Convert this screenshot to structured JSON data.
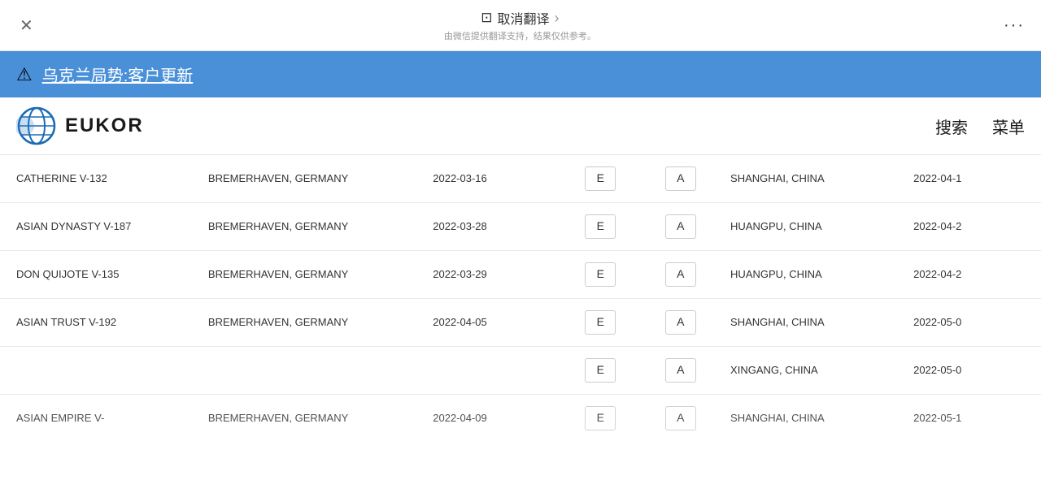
{
  "topbar": {
    "close_label": "✕",
    "translate_icon": "⊞",
    "translate_label": "取消翻译",
    "translate_chevron": "›",
    "translate_subtitle": "由微信提供翻译支持，结果仅供参考。",
    "more_label": "···"
  },
  "warning": {
    "icon": "⚠",
    "text": "乌克兰局势:客户更新"
  },
  "header": {
    "logo_text": "EUKOR",
    "search_label": "搜索",
    "menu_label": "菜单"
  },
  "table": {
    "rows": [
      {
        "vessel": "CATHERINE V-132",
        "port_from": "BREMERHAVEN, GERMANY",
        "date_from": "2022-03-16",
        "badge_e": "E",
        "badge_a": "A",
        "port_to": "SHANGHAI, CHINA",
        "date_to": "2022-04-1",
        "partial": false
      },
      {
        "vessel": "ASIAN DYNASTY V-187",
        "port_from": "BREMERHAVEN, GERMANY",
        "date_from": "2022-03-28",
        "badge_e": "E",
        "badge_a": "A",
        "port_to": "HUANGPU, CHINA",
        "date_to": "2022-04-2",
        "partial": false
      },
      {
        "vessel": "DON QUIJOTE V-135",
        "port_from": "BREMERHAVEN, GERMANY",
        "date_from": "2022-03-29",
        "badge_e": "E",
        "badge_a": "A",
        "port_to": "HUANGPU, CHINA",
        "date_to": "2022-04-2",
        "partial": false
      },
      {
        "vessel": "ASIAN TRUST V-192",
        "port_from": "BREMERHAVEN, GERMANY",
        "date_from": "2022-04-05",
        "badge_e": "E",
        "badge_a": "A",
        "port_to": "SHANGHAI, CHINA",
        "date_to": "2022-05-0",
        "partial": false
      },
      {
        "vessel": "",
        "port_from": "",
        "date_from": "",
        "badge_e": "E",
        "badge_a": "A",
        "port_to": "XINGANG, CHINA",
        "date_to": "2022-05-0",
        "partial": false
      },
      {
        "vessel": "ASIAN EMPIRE V-",
        "port_from": "BREMERHAVEN, GERMANY",
        "date_from": "2022-04-09",
        "badge_e": "E",
        "badge_a": "A",
        "port_to": "SHANGHAI, CHINA",
        "date_to": "2022-05-1",
        "partial": true
      }
    ]
  }
}
